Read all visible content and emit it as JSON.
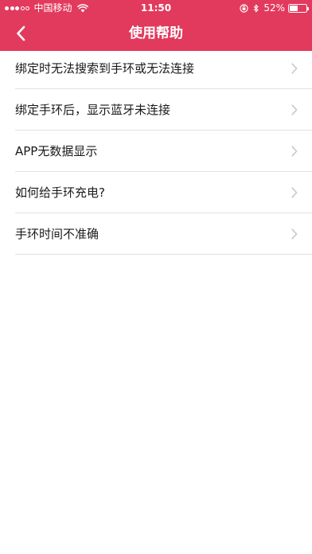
{
  "status_bar": {
    "carrier": "中国移动",
    "time": "11:50",
    "battery_percent": "52%",
    "battery_level": 0.52,
    "signal_bars": 3,
    "signal_total": 5,
    "icons": [
      "signal-dots-icon",
      "wifi-icon",
      "lock-rotation-icon",
      "bluetooth-icon",
      "battery-icon"
    ]
  },
  "nav": {
    "title": "使用帮助",
    "back_icon": "chevron-left-icon"
  },
  "colors": {
    "accent": "#e23a5d",
    "divider": "#e2e2e2",
    "chevron": "#c7c7cc"
  },
  "help_items": [
    {
      "label": "绑定时无法搜索到手环或无法连接"
    },
    {
      "label": "绑定手环后，显示蓝牙未连接"
    },
    {
      "label": "APP无数据显示"
    },
    {
      "label": "如何给手环充电?"
    },
    {
      "label": "手环时间不准确"
    }
  ]
}
